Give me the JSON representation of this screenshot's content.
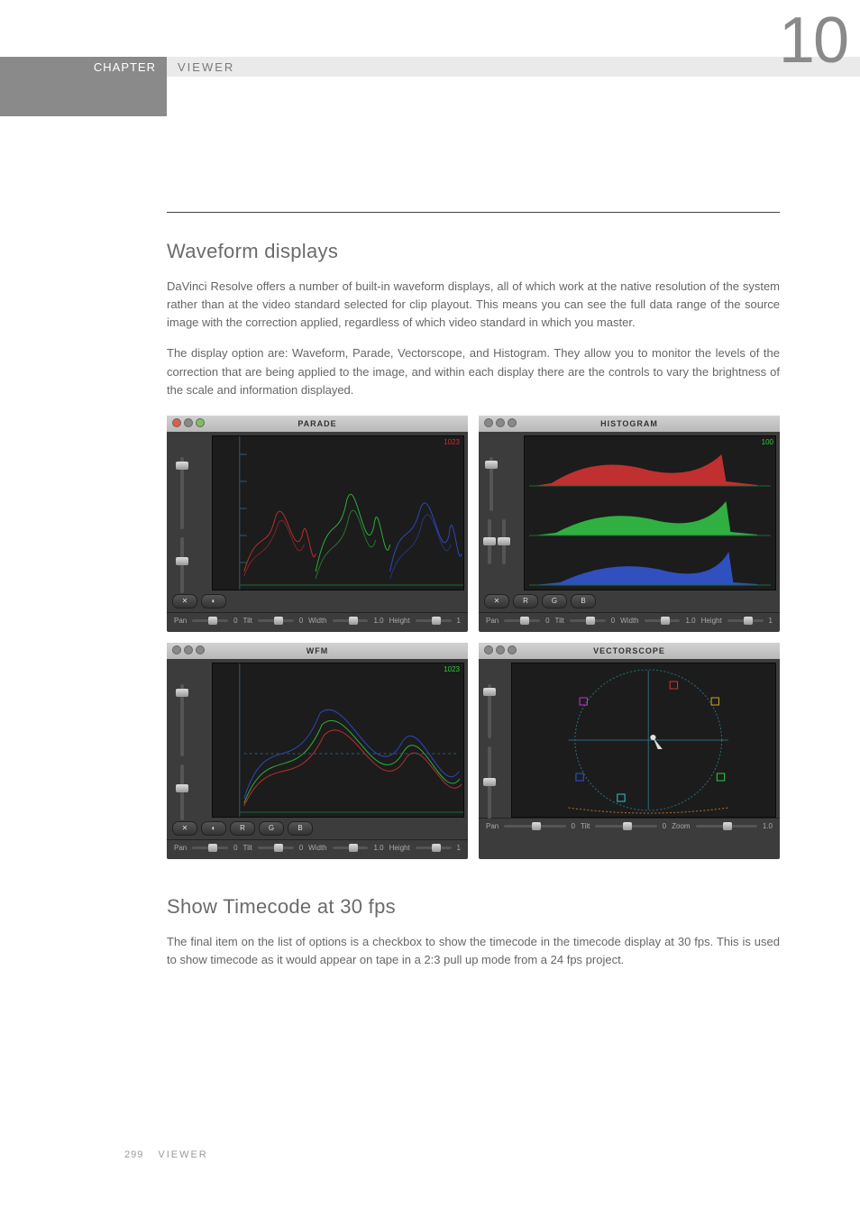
{
  "header": {
    "chapter_label": "CHAPTER",
    "chapter_number": "10",
    "title": "VIEWER"
  },
  "sections": {
    "waveform": {
      "heading": "Waveform displays",
      "p1": "DaVinci Resolve offers a number of built-in waveform displays, all of which work at the native resolution of the system rather than at the video standard selected for clip playout. This means you can see the full data range of the source image with the correction applied, regardless of which video standard in which you master.",
      "p2": "The display option are: Waveform, Parade, Vectorscope, and Histogram. They allow you to monitor the levels of the correction that are being applied to the image, and within each display there are the controls to vary the brightness of the scale and information displayed."
    },
    "timecode": {
      "heading": "Show Timecode at 30 fps",
      "p1": "The final item on the list of options is a checkbox to show the timecode in the timecode display at 30 fps. This is used  to show timecode as it would appear on tape in a 2:3 pull up mode from a 24 fps project."
    }
  },
  "scopes": {
    "parade": {
      "title": "PARADE",
      "ruler": "1023",
      "footer": {
        "pan": "Pan",
        "pan_v": "0",
        "tilt": "Tilt",
        "tilt_v": "0",
        "width": "Width",
        "width_v": "1.0",
        "height": "Height",
        "height_v": "1"
      }
    },
    "histogram": {
      "title": "HISTOGRAM",
      "ruler": "100",
      "footer": {
        "pan": "Pan",
        "pan_v": "0",
        "tilt": "Tilt",
        "tilt_v": "0",
        "width": "Width",
        "width_v": "1.0",
        "height": "Height",
        "height_v": "1"
      },
      "rgb": {
        "r": "R",
        "g": "G",
        "b": "B"
      }
    },
    "wfm": {
      "title": "WFM",
      "ruler": "1023",
      "footer": {
        "pan": "Pan",
        "pan_v": "0",
        "tilt": "Tilt",
        "tilt_v": "0",
        "width": "Width",
        "width_v": "1.0",
        "height": "Height",
        "height_v": "1"
      },
      "rgb": {
        "r": "R",
        "g": "G",
        "b": "B"
      }
    },
    "vectorscope": {
      "title": "VECTORSCOPE",
      "footer": {
        "pan": "Pan",
        "pan_v": "0",
        "tilt": "Tilt",
        "tilt_v": "0",
        "zoom": "Zoom",
        "zoom_v": "1.0"
      }
    }
  },
  "footer": {
    "page": "299",
    "label": "VIEWER"
  }
}
